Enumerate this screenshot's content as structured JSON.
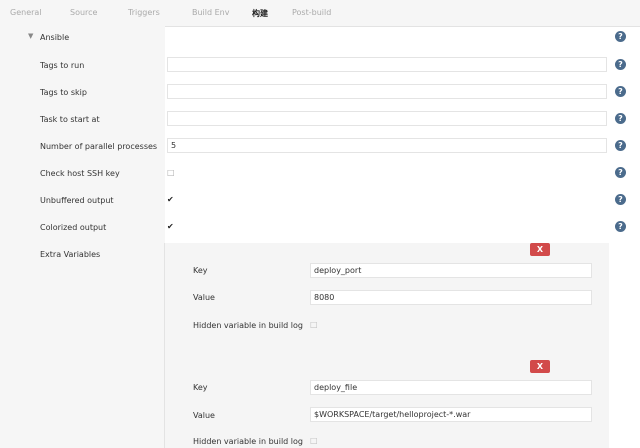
{
  "tabs": [
    "General",
    "Source",
    "Triggers",
    "Build Env",
    "构建",
    "Post-build"
  ],
  "active_tab_index": 4,
  "section": {
    "title": "Ansible"
  },
  "fields": {
    "tags_to_run": {
      "label": "Tags to run",
      "value": ""
    },
    "tags_to_skip": {
      "label": "Tags to skip",
      "value": ""
    },
    "task_to_start_at": {
      "label": "Task to start at",
      "value": ""
    },
    "parallel": {
      "label": "Number of parallel processes",
      "value": "5"
    },
    "check_host_ssh_key": {
      "label": "Check host SSH key",
      "checked": false
    },
    "unbuffered_output": {
      "label": "Unbuffered output",
      "checked": true
    },
    "colorized_output": {
      "label": "Colorized output",
      "checked": true
    },
    "extra_variables": {
      "label": "Extra Variables"
    }
  },
  "help_glyph": "?",
  "delete_glyph": "X",
  "check_glyph": "✔",
  "uncheck_glyph": "□",
  "extra_vars": [
    {
      "key_label": "Key",
      "key": "deploy_port",
      "value_label": "Value",
      "value": "8080",
      "hidden_label": "Hidden variable in build log"
    },
    {
      "key_label": "Key",
      "key": "deploy_file",
      "value_label": "Value",
      "value": "$WORKSPACE/target/helloproject-*.war",
      "hidden_label": "Hidden variable in build log"
    }
  ],
  "colors": {
    "help": "#4b6b8c",
    "delete": "#d24a4a"
  }
}
